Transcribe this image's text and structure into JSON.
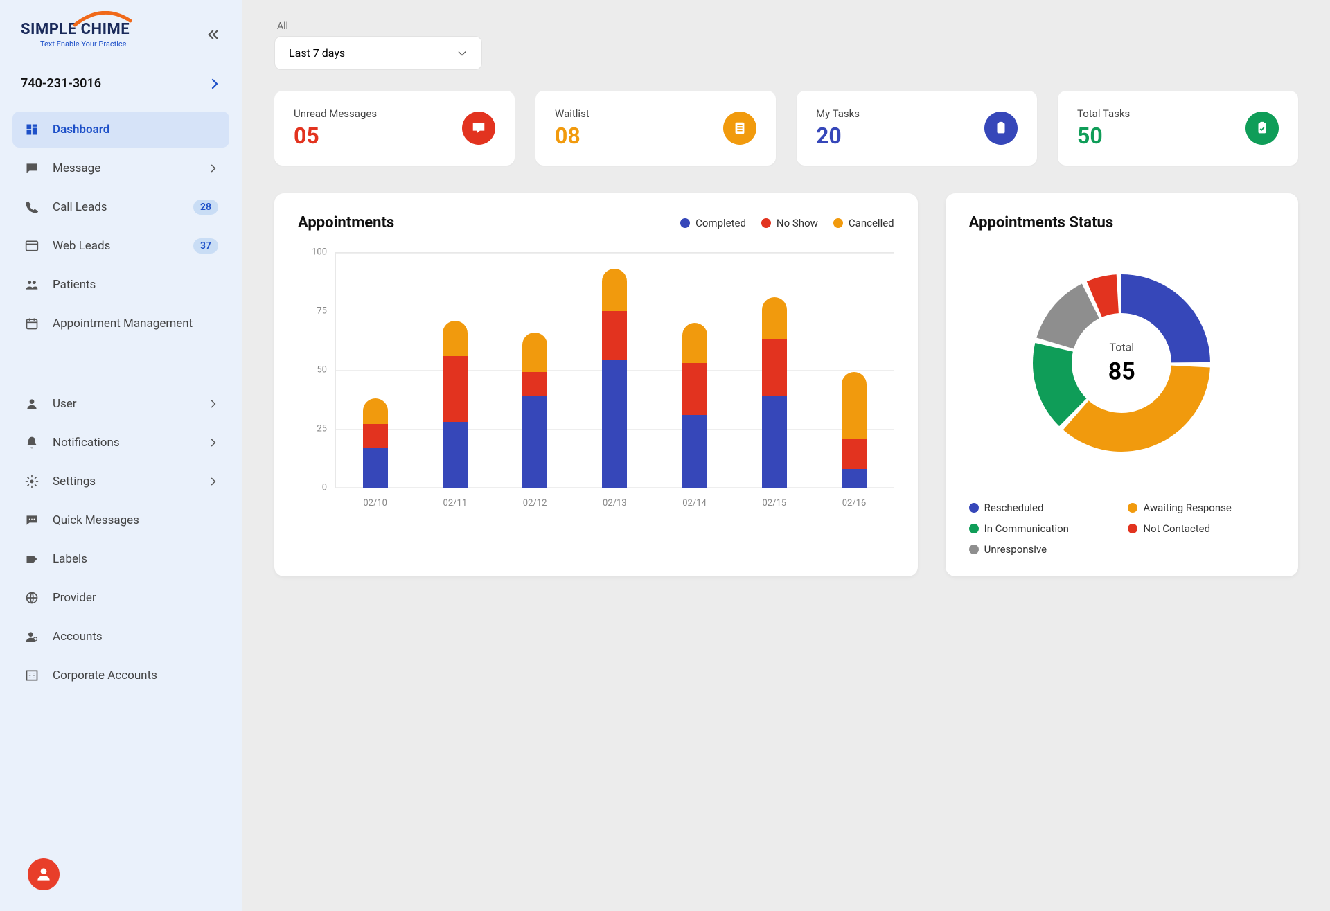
{
  "brand": {
    "name": "SIMPLE CHIME",
    "tag": "Text Enable Your Practice"
  },
  "phone": "740-231-3016",
  "sidebar": {
    "items": [
      {
        "label": "Dashboard",
        "icon": "dashboard-icon",
        "active": true
      },
      {
        "label": "Message",
        "icon": "message-icon",
        "expandable": true
      },
      {
        "label": "Call Leads",
        "icon": "phone-icon",
        "badge": "28"
      },
      {
        "label": "Web Leads",
        "icon": "web-icon",
        "badge": "37"
      },
      {
        "label": "Patients",
        "icon": "people-icon"
      },
      {
        "label": "Appointment Management",
        "icon": "calendar-icon"
      }
    ],
    "secondary": [
      {
        "label": "User",
        "icon": "user-icon",
        "expandable": true
      },
      {
        "label": "Notifications",
        "icon": "bell-icon",
        "expandable": true
      },
      {
        "label": "Settings",
        "icon": "gear-icon",
        "expandable": true
      },
      {
        "label": "Quick Messages",
        "icon": "chat-icon"
      },
      {
        "label": "Labels",
        "icon": "label-icon"
      },
      {
        "label": "Provider",
        "icon": "globe-icon"
      },
      {
        "label": "Accounts",
        "icon": "account-icon"
      },
      {
        "label": "Corporate Accounts",
        "icon": "corporate-icon"
      }
    ]
  },
  "filter": {
    "scope": "All",
    "range": "Last 7 days"
  },
  "kpis": [
    {
      "label": "Unread Messages",
      "value": "05",
      "color": "#e2331f",
      "icon": "chat-fill-icon"
    },
    {
      "label": "Waitlist",
      "value": "08",
      "color": "#f19a0d",
      "icon": "list-icon"
    },
    {
      "label": "My Tasks",
      "value": "20",
      "color": "#3647b9",
      "icon": "clipboard-icon"
    },
    {
      "label": "Total Tasks",
      "value": "50",
      "color": "#0f9d58",
      "icon": "clipboard-check-icon"
    }
  ],
  "appointments": {
    "title": "Appointments",
    "legend": [
      {
        "label": "Completed",
        "color": "#3647b9"
      },
      {
        "label": "No Show",
        "color": "#e2331f"
      },
      {
        "label": "Cancelled",
        "color": "#f19a0d"
      }
    ]
  },
  "status": {
    "title": "Appointments Status",
    "center_label": "Total",
    "center_value": "85",
    "legend": [
      {
        "label": "Rescheduled",
        "color": "#3647b9"
      },
      {
        "label": "Awaiting Response",
        "color": "#f19a0d"
      },
      {
        "label": "In Communication",
        "color": "#0f9d58"
      },
      {
        "label": "Not Contacted",
        "color": "#e2331f"
      },
      {
        "label": "Unresponsive",
        "color": "#8e8e8e"
      }
    ]
  },
  "chart_data": [
    {
      "type": "bar",
      "title": "Appointments",
      "categories": [
        "02/10",
        "02/11",
        "02/12",
        "02/13",
        "02/14",
        "02/15",
        "02/16"
      ],
      "series": [
        {
          "name": "Completed",
          "values": [
            17,
            28,
            39,
            54,
            31,
            39,
            8
          ]
        },
        {
          "name": "No Show",
          "values": [
            10,
            28,
            10,
            21,
            22,
            24,
            13
          ]
        },
        {
          "name": "Cancelled",
          "values": [
            11,
            15,
            17,
            18,
            17,
            18,
            28
          ]
        }
      ],
      "ylim": [
        0,
        100
      ],
      "yticks": [
        0,
        25,
        50,
        75,
        100
      ],
      "xlabel": "",
      "ylabel": ""
    },
    {
      "type": "pie",
      "title": "Appointments Status",
      "series": [
        {
          "name": "Rescheduled",
          "value": 24,
          "color": "#3647b9"
        },
        {
          "name": "Awaiting Response",
          "value": 34,
          "color": "#f19a0d"
        },
        {
          "name": "In Communication",
          "value": 16,
          "color": "#0f9d58"
        },
        {
          "name": "Unresponsive",
          "value": 13,
          "color": "#8e8e8e"
        },
        {
          "name": "Not Contacted",
          "value": 6,
          "color": "#e2331f"
        }
      ],
      "total": 85
    }
  ]
}
